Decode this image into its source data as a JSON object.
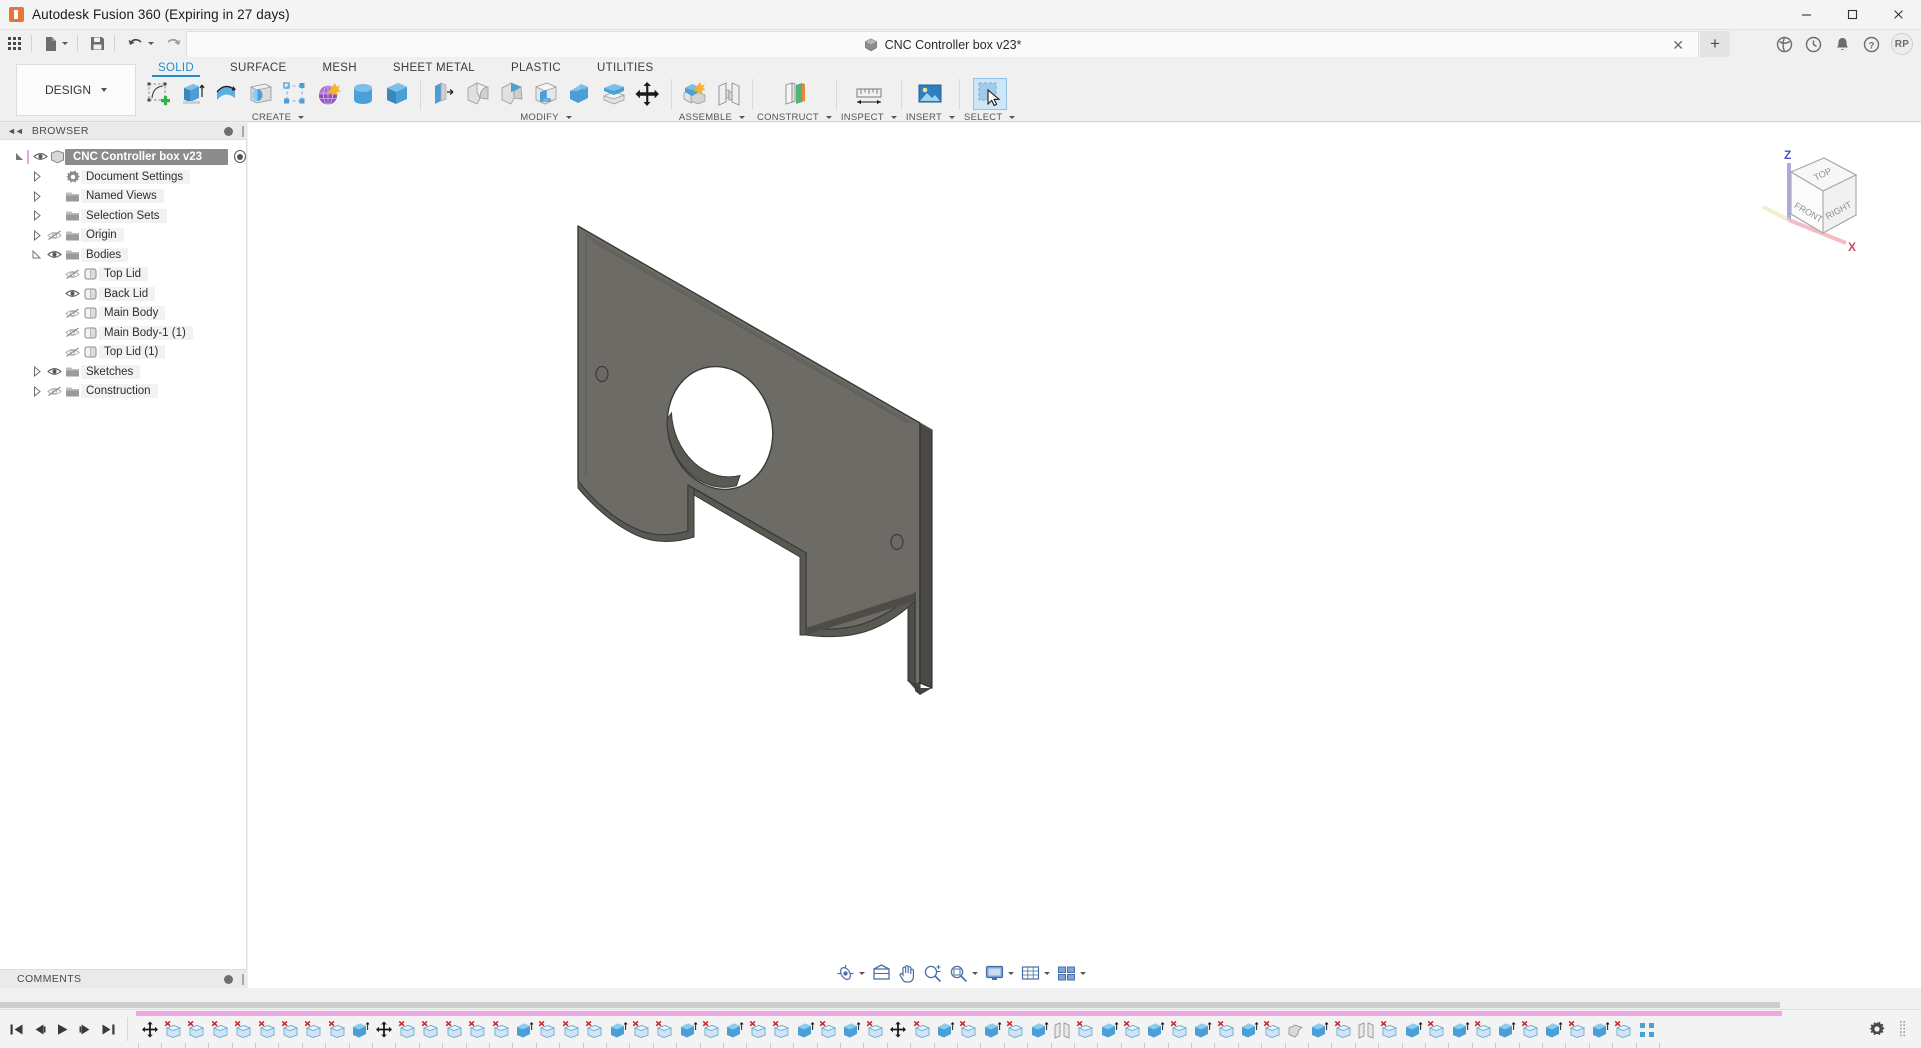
{
  "window": {
    "title": "Autodesk Fusion 360 (Expiring in 27 days)",
    "logo_icon": "fusion-logo-icon",
    "minimize_label": "Minimize",
    "maximize_label": "Maximize",
    "close_label": "Close"
  },
  "quick_access": {
    "items": [
      {
        "name": "app-grid-button",
        "icon": "grid-icon"
      },
      {
        "name": "new-document-button",
        "icon": "file-icon",
        "has_caret": true
      },
      {
        "name": "save-button",
        "icon": "save-icon",
        "has_caret": true
      },
      {
        "name": "undo-button",
        "icon": "undo-icon",
        "has_caret": true
      },
      {
        "name": "redo-button",
        "icon": "redo-icon",
        "has_caret": true
      }
    ]
  },
  "document_tab": {
    "label": "CNC Controller box v23*",
    "icon": "body-cube-icon",
    "close_icon": "close-icon",
    "new_tab_icon": "plus-icon"
  },
  "title_right_icons": [
    {
      "name": "extension-icon",
      "glyph": "extension"
    },
    {
      "name": "job-status-icon",
      "glyph": "clock"
    },
    {
      "name": "notifications-icon",
      "glyph": "bell"
    },
    {
      "name": "help-icon",
      "glyph": "question"
    }
  ],
  "account": {
    "initials": "RP"
  },
  "workspace": {
    "label": "DESIGN",
    "icon": "design-icon"
  },
  "ribbon": {
    "tabs": [
      {
        "label": "SOLID",
        "active": true
      },
      {
        "label": "SURFACE",
        "active": false
      },
      {
        "label": "MESH",
        "active": false
      },
      {
        "label": "SHEET METAL",
        "active": false
      },
      {
        "label": "PLASTIC",
        "active": false
      },
      {
        "label": "UTILITIES",
        "active": false
      }
    ],
    "panels": [
      {
        "label": "CREATE",
        "has_caret": true,
        "items": [
          {
            "name": "create-sketch-button",
            "icon": "create-sketch-icon"
          },
          {
            "name": "extrude-button",
            "icon": "extrude-icon"
          },
          {
            "name": "revolve-button",
            "icon": "revolve-icon"
          },
          {
            "name": "sweep-button",
            "icon": "sweep-icon"
          },
          {
            "name": "pattern-button",
            "icon": "pattern-icon"
          },
          {
            "name": "form-button",
            "icon": "form-icon"
          },
          {
            "name": "cylinder-primitive-button",
            "icon": "cylinder-icon"
          },
          {
            "name": "box-primitive-button",
            "icon": "box-icon"
          }
        ]
      },
      {
        "label": "MODIFY",
        "has_caret": true,
        "items": [
          {
            "name": "press-pull-button",
            "icon": "press-pull-icon"
          },
          {
            "name": "fillet-button",
            "icon": "fillet-icon"
          },
          {
            "name": "chamfer-button",
            "icon": "chamfer-icon"
          },
          {
            "name": "shell-button",
            "icon": "shell-icon"
          },
          {
            "name": "combine-button",
            "icon": "combine-icon"
          },
          {
            "name": "split-face-button",
            "icon": "split-face-icon"
          },
          {
            "name": "move-copy-button",
            "icon": "move-copy-icon"
          }
        ]
      },
      {
        "label": "ASSEMBLE",
        "has_caret": true,
        "items": [
          {
            "name": "new-component-button",
            "icon": "new-component-icon"
          },
          {
            "name": "joint-button",
            "icon": "joint-icon"
          }
        ]
      },
      {
        "label": "CONSTRUCT",
        "has_caret": true,
        "items": [
          {
            "name": "offset-plane-button",
            "icon": "offset-plane-icon"
          }
        ]
      },
      {
        "label": "INSPECT",
        "has_caret": true,
        "items": [
          {
            "name": "measure-button",
            "icon": "measure-icon"
          }
        ]
      },
      {
        "label": "INSERT",
        "has_caret": true,
        "items": [
          {
            "name": "insert-mcmaster-button",
            "icon": "insert-image-icon"
          }
        ]
      },
      {
        "label": "SELECT",
        "has_caret": true,
        "items": [
          {
            "name": "select-tool-button",
            "icon": "select-cursor-icon",
            "selected": true
          }
        ]
      }
    ]
  },
  "browser": {
    "header": "BROWSER",
    "collapse_icon": "collapse-left-icon",
    "settings_icon": "panel-dot-icon",
    "tree": [
      {
        "label": "CNC Controller box v23",
        "indent": 0,
        "root": true,
        "expanded": true,
        "visible": true,
        "icon": "component-icon"
      },
      {
        "label": "Document Settings",
        "indent": 1,
        "expanded": false,
        "icon": "gear-icon",
        "eye": "none"
      },
      {
        "label": "Named Views",
        "indent": 1,
        "expanded": false,
        "icon": "folder-icon",
        "eye": "none"
      },
      {
        "label": "Selection Sets",
        "indent": 1,
        "expanded": false,
        "icon": "folder-icon",
        "eye": "none"
      },
      {
        "label": "Origin",
        "indent": 1,
        "expanded": false,
        "icon": "folder-icon",
        "eye": "hidden"
      },
      {
        "label": "Bodies",
        "indent": 1,
        "expanded": true,
        "icon": "folder-icon",
        "eye": "visible"
      },
      {
        "label": "Top Lid",
        "indent": 2,
        "icon": "body-icon",
        "eye": "hidden"
      },
      {
        "label": "Back Lid",
        "indent": 2,
        "icon": "body-icon",
        "eye": "visible"
      },
      {
        "label": "Main Body",
        "indent": 2,
        "icon": "body-icon",
        "eye": "hidden"
      },
      {
        "label": "Main Body-1 (1)",
        "indent": 2,
        "icon": "body-icon",
        "eye": "hidden"
      },
      {
        "label": "Top Lid (1)",
        "indent": 2,
        "icon": "body-icon",
        "eye": "hidden"
      },
      {
        "label": "Sketches",
        "indent": 1,
        "expanded": false,
        "icon": "folder-icon",
        "eye": "visible"
      },
      {
        "label": "Construction",
        "indent": 1,
        "expanded": false,
        "icon": "folder-icon",
        "eye": "hidden"
      }
    ]
  },
  "comments": {
    "label": "COMMENTS",
    "settings_icon": "panel-dot-icon"
  },
  "view_cube": {
    "top_face": "TOP",
    "front_face": "FRONT",
    "right_face": "RIGHT",
    "axis_z": "Z",
    "axis_x": "X"
  },
  "nav_bar": {
    "items": [
      {
        "name": "orbit-button",
        "icon": "orbit-icon",
        "has_caret": true
      },
      {
        "name": "look-at-button",
        "icon": "look-at-icon",
        "has_caret": false
      },
      {
        "name": "pan-button",
        "icon": "pan-hand-icon",
        "has_caret": false
      },
      {
        "name": "zoom-button",
        "icon": "zoom-magnifier-icon",
        "has_caret": false
      },
      {
        "name": "fit-button",
        "icon": "fit-magnifier-icon",
        "has_caret": true
      },
      {
        "name": "display-settings-button",
        "icon": "monitor-icon",
        "has_caret": true
      },
      {
        "name": "grid-snaps-button",
        "icon": "grid-icon",
        "has_caret": true
      },
      {
        "name": "viewports-button",
        "icon": "viewports-icon",
        "has_caret": true
      }
    ]
  },
  "timeline": {
    "playback": [
      {
        "name": "timeline-begin-button",
        "icon": "skip-start-icon"
      },
      {
        "name": "timeline-step-back-button",
        "icon": "step-back-icon"
      },
      {
        "name": "timeline-play-button",
        "icon": "play-icon"
      },
      {
        "name": "timeline-step-forward-button",
        "icon": "step-forward-icon"
      },
      {
        "name": "timeline-end-button",
        "icon": "skip-end-icon"
      }
    ],
    "features": [
      {
        "icon": "move-feature-icon",
        "type": "move"
      },
      {
        "icon": "sketch-feature-icon",
        "type": "sketch"
      },
      {
        "icon": "sketch-feature-icon",
        "type": "sketch"
      },
      {
        "icon": "sketch-feature-icon",
        "type": "sketch"
      },
      {
        "icon": "sketch-feature-icon",
        "type": "sketch"
      },
      {
        "icon": "sketch-feature-icon",
        "type": "sketch"
      },
      {
        "icon": "sketch-feature-icon",
        "type": "sketch"
      },
      {
        "icon": "sketch-feature-icon",
        "type": "sketch"
      },
      {
        "icon": "sketch-feature-icon",
        "type": "sketch"
      },
      {
        "icon": "extrude-feature-icon",
        "type": "extrude"
      },
      {
        "icon": "move-feature-icon",
        "type": "move"
      },
      {
        "icon": "sketch-feature-icon",
        "type": "sketch"
      },
      {
        "icon": "sketch-feature-icon",
        "type": "sketch"
      },
      {
        "icon": "sketch-feature-icon",
        "type": "sketch"
      },
      {
        "icon": "sketch-feature-icon",
        "type": "sketch"
      },
      {
        "icon": "sketch-feature-icon",
        "type": "sketch"
      },
      {
        "icon": "extrude-feature-icon",
        "type": "extrude"
      },
      {
        "icon": "sketch-feature-icon",
        "type": "sketch"
      },
      {
        "icon": "sketch-feature-icon",
        "type": "sketch"
      },
      {
        "icon": "sketch-feature-icon",
        "type": "sketch"
      },
      {
        "icon": "extrude-feature-icon",
        "type": "extrude"
      },
      {
        "icon": "sketch-feature-icon",
        "type": "sketch"
      },
      {
        "icon": "sketch-feature-icon",
        "type": "sketch"
      },
      {
        "icon": "extrude-feature-icon",
        "type": "extrude"
      },
      {
        "icon": "sketch-feature-icon",
        "type": "sketch"
      },
      {
        "icon": "extrude-feature-icon",
        "type": "extrude"
      },
      {
        "icon": "sketch-feature-icon",
        "type": "sketch"
      },
      {
        "icon": "sketch-feature-icon",
        "type": "sketch"
      },
      {
        "icon": "extrude-feature-icon",
        "type": "extrude"
      },
      {
        "icon": "sketch-feature-icon",
        "type": "sketch"
      },
      {
        "icon": "extrude-feature-icon",
        "type": "extrude"
      },
      {
        "icon": "sketch-feature-icon",
        "type": "sketch"
      },
      {
        "icon": "move-feature-icon",
        "type": "move"
      },
      {
        "icon": "sketch-feature-icon",
        "type": "sketch"
      },
      {
        "icon": "extrude-feature-icon",
        "type": "extrude"
      },
      {
        "icon": "sketch-feature-icon",
        "type": "sketch"
      },
      {
        "icon": "extrude-feature-icon",
        "type": "extrude"
      },
      {
        "icon": "sketch-feature-icon",
        "type": "sketch"
      },
      {
        "icon": "extrude-feature-icon",
        "type": "extrude"
      },
      {
        "icon": "mirror-feature-icon",
        "type": "mirror"
      },
      {
        "icon": "sketch-feature-icon",
        "type": "sketch"
      },
      {
        "icon": "extrude-feature-icon",
        "type": "extrude"
      },
      {
        "icon": "sketch-feature-icon",
        "type": "sketch"
      },
      {
        "icon": "extrude-feature-icon",
        "type": "extrude"
      },
      {
        "icon": "sketch-feature-icon",
        "type": "sketch"
      },
      {
        "icon": "extrude-feature-icon",
        "type": "extrude"
      },
      {
        "icon": "sketch-feature-icon",
        "type": "sketch"
      },
      {
        "icon": "extrude-feature-icon",
        "type": "extrude"
      },
      {
        "icon": "sketch-feature-icon",
        "type": "sketch"
      },
      {
        "icon": "fillet-feature-icon",
        "type": "fillet"
      },
      {
        "icon": "extrude-feature-icon",
        "type": "extrude"
      },
      {
        "icon": "sketch-feature-icon",
        "type": "sketch"
      },
      {
        "icon": "mirror-feature-icon",
        "type": "mirror"
      },
      {
        "icon": "sketch-feature-icon",
        "type": "sketch"
      },
      {
        "icon": "extrude-feature-icon",
        "type": "extrude"
      },
      {
        "icon": "sketch-feature-icon",
        "type": "sketch"
      },
      {
        "icon": "extrude-feature-icon",
        "type": "extrude"
      },
      {
        "icon": "sketch-feature-icon",
        "type": "sketch"
      },
      {
        "icon": "extrude-feature-icon",
        "type": "extrude"
      },
      {
        "icon": "sketch-feature-icon",
        "type": "sketch"
      },
      {
        "icon": "extrude-feature-icon",
        "type": "extrude"
      },
      {
        "icon": "sketch-feature-icon",
        "type": "sketch"
      },
      {
        "icon": "extrude-feature-icon",
        "type": "extrude"
      },
      {
        "icon": "sketch-feature-icon",
        "type": "sketch"
      },
      {
        "icon": "pattern-feature-icon",
        "type": "pattern"
      }
    ],
    "settings_icon": "gear-icon",
    "grip_icon": "grip-icon"
  },
  "model": {
    "name": "back-lid-plate",
    "body_fill": "#6b6963",
    "body_edge": "#3a3936",
    "body_side": "#55534e"
  },
  "colors": {
    "accent": "#1a8fd1",
    "titlebar_bg": "#f4f4f4",
    "ribbon_bg": "#f0f0f0",
    "canvas_bg": "#ffffff",
    "timeline_pink": "#f0a8e0",
    "tree_selected": "#8c8c8c"
  }
}
